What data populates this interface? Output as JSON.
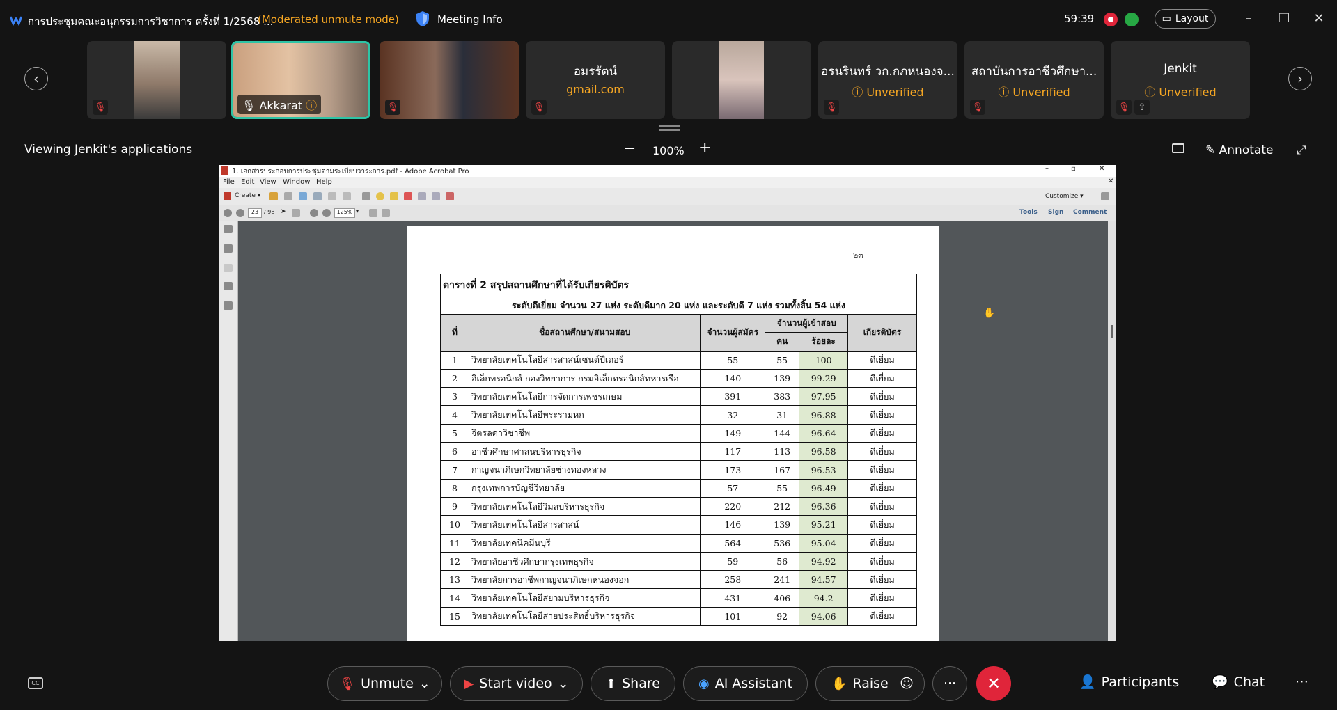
{
  "meeting": {
    "title": "การประชุมคณะอนุกรรมการวิชาการ ครั้งที่ 1/2568 ...",
    "mode": "(Moderated unmute mode)",
    "info_label": "Meeting Info",
    "timer": "59:39",
    "layout_label": "Layout"
  },
  "participants": [
    {
      "name": "",
      "type": "video",
      "muted": true
    },
    {
      "name": "Akkarat",
      "type": "video",
      "active": true
    },
    {
      "name": "",
      "type": "video",
      "muted": true
    },
    {
      "name": "อมรรัตน์",
      "sub": "gmail.com",
      "type": "name",
      "muted": true
    },
    {
      "name": "",
      "type": "video"
    },
    {
      "name": "อรนรินทร์ วก.กภหนองจ...",
      "sub": "Unverified",
      "type": "name",
      "muted": true
    },
    {
      "name": "สถาบันการอาชีวศึกษา...",
      "sub": "Unverified",
      "type": "name",
      "muted": true
    },
    {
      "name": "Jenkit",
      "sub": "Unverified",
      "type": "name",
      "muted": true
    }
  ],
  "share": {
    "viewing": "Viewing Jenkit's applications",
    "zoom": "100%",
    "annotate": "Annotate"
  },
  "acrobat": {
    "window_title": "1. เอกสารประกอบการประชุมตามระเบียบวาระการ.pdf - Adobe Acrobat Pro",
    "menu": [
      "File",
      "Edit",
      "View",
      "Window",
      "Help"
    ],
    "create": "Create",
    "customize": "Customize",
    "page_current": "23",
    "page_total": "/ 98",
    "zoom": "125%",
    "right_tools": [
      "Tools",
      "Sign",
      "Comment"
    ]
  },
  "document": {
    "page_number": "๒๓",
    "caption1": "ตารางที่ 2  สรุปสถานศึกษาที่ได้รับเกียรติบัตร",
    "caption2": "ระดับดีเยี่ยม จำนวน 27 แห่ง ระดับดีมาก 20 แห่ง และระดับดี 7 แห่ง รวมทั้งสิ้น 54 แห่ง",
    "headers": {
      "no": "ที่",
      "name": "ชื่อสถานศึกษา/สนามสอบ",
      "applicants": "จำนวนผู้สมัคร",
      "attendees": "จำนวนผู้เข้าสอบ",
      "persons": "คน",
      "percent": "ร้อยละ",
      "award": "เกียรติบัตร"
    },
    "rows": [
      {
        "no": "1",
        "name": "วิทยาลัยเทคโนโลยีสารสาสน์เซนต์ปีเตอร์",
        "applicants": "55",
        "persons": "55",
        "percent": "100",
        "award": "ดีเยี่ยม"
      },
      {
        "no": "2",
        "name": "อิเล็กทรอนิกส์ กองวิทยาการ กรมอิเล็กทรอนิกส์ทหารเรือ",
        "applicants": "140",
        "persons": "139",
        "percent": "99.29",
        "award": "ดีเยี่ยม"
      },
      {
        "no": "3",
        "name": "วิทยาลัยเทคโนโลยีการจัดการเพชรเกษม",
        "applicants": "391",
        "persons": "383",
        "percent": "97.95",
        "award": "ดีเยี่ยม"
      },
      {
        "no": "4",
        "name": "วิทยาลัยเทคโนโลยีพระรามหก",
        "applicants": "32",
        "persons": "31",
        "percent": "96.88",
        "award": "ดีเยี่ยม"
      },
      {
        "no": "5",
        "name": "จิตรลดาวิชาชีพ",
        "applicants": "149",
        "persons": "144",
        "percent": "96.64",
        "award": "ดีเยี่ยม"
      },
      {
        "no": "6",
        "name": "อาชีวศึกษาศาสนบริหารธุรกิจ",
        "applicants": "117",
        "persons": "113",
        "percent": "96.58",
        "award": "ดีเยี่ยม"
      },
      {
        "no": "7",
        "name": "กาญจนาภิเษกวิทยาลัยช่างทองหลวง",
        "applicants": "173",
        "persons": "167",
        "percent": "96.53",
        "award": "ดีเยี่ยม"
      },
      {
        "no": "8",
        "name": "กรุงเทพการบัญชีวิทยาลัย",
        "applicants": "57",
        "persons": "55",
        "percent": "96.49",
        "award": "ดีเยี่ยม"
      },
      {
        "no": "9",
        "name": "วิทยาลัยเทคโนโลยีวิมลบริหารธุรกิจ",
        "applicants": "220",
        "persons": "212",
        "percent": "96.36",
        "award": "ดีเยี่ยม"
      },
      {
        "no": "10",
        "name": "วิทยาลัยเทคโนโลยีสารสาสน์",
        "applicants": "146",
        "persons": "139",
        "percent": "95.21",
        "award": "ดีเยี่ยม"
      },
      {
        "no": "11",
        "name": "วิทยาลัยเทคนิคมีนบุรี",
        "applicants": "564",
        "persons": "536",
        "percent": "95.04",
        "award": "ดีเยี่ยม"
      },
      {
        "no": "12",
        "name": "วิทยาลัยอาชีวศึกษากรุงเทพธุรกิจ",
        "applicants": "59",
        "persons": "56",
        "percent": "94.92",
        "award": "ดีเยี่ยม"
      },
      {
        "no": "13",
        "name": "วิทยาลัยการอาชีพกาญจนาภิเษกหนองจอก",
        "applicants": "258",
        "persons": "241",
        "percent": "94.57",
        "award": "ดีเยี่ยม"
      },
      {
        "no": "14",
        "name": "วิทยาลัยเทคโนโลยีสยามบริหารธุรกิจ",
        "applicants": "431",
        "persons": "406",
        "percent": "94.2",
        "award": "ดีเยี่ยม"
      },
      {
        "no": "15",
        "name": "วิทยาลัยเทคโนโลยีสายประสิทธิ์บริหารธุรกิจ",
        "applicants": "101",
        "persons": "92",
        "percent": "94.06",
        "award": "ดีเยี่ยม"
      }
    ]
  },
  "controls": {
    "unmute": "Unmute",
    "start_video": "Start video",
    "share": "Share",
    "ai_assistant": "AI Assistant",
    "raise": "Raise",
    "participants": "Participants",
    "chat": "Chat"
  },
  "colors": {
    "accent_orange": "#f5a623",
    "active_border": "#2ec4a6",
    "end_call": "#e0253a",
    "percent_cell": "#dfead0"
  }
}
